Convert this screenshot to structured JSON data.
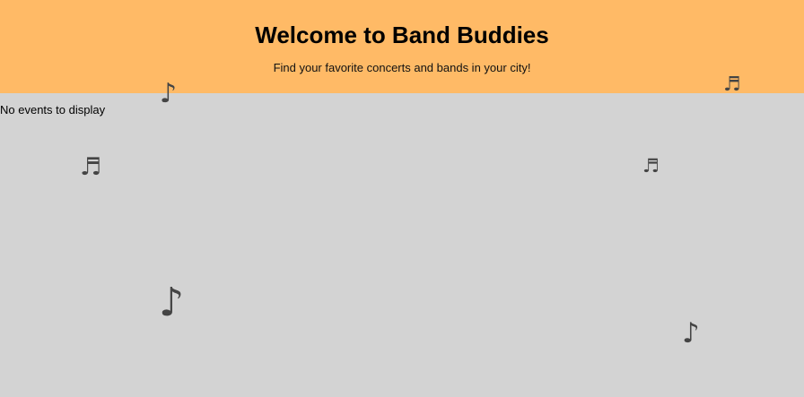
{
  "header": {
    "title": "Welcome to Band Buddies",
    "subtitle": "Find your favorite concerts and bands in your city!"
  },
  "events": {
    "empty_message": "No events to display",
    "items": []
  },
  "decorations": {
    "icon_color": "#444444",
    "header_bg": "#ffba66",
    "page_bg": "#d3d3d3",
    "notes": [
      {
        "name": "eighth-note-icon",
        "glyph": "♪"
      },
      {
        "name": "beamed-notes-icon",
        "glyph": "♬"
      },
      {
        "name": "beamed-notes-icon",
        "glyph": "♬"
      },
      {
        "name": "beamed-notes-icon",
        "glyph": "♬"
      },
      {
        "name": "eighth-note-icon",
        "glyph": "♪"
      },
      {
        "name": "eighth-note-icon",
        "glyph": "♪"
      }
    ]
  }
}
